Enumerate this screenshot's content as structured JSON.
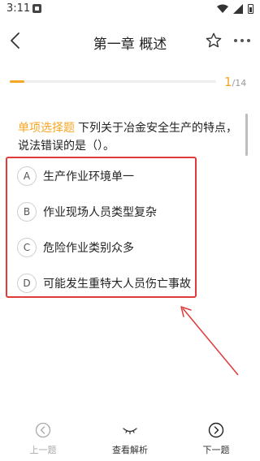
{
  "status_bar": {
    "time": "3:11"
  },
  "header": {
    "title": "第一章 概述"
  },
  "progress": {
    "current": "1",
    "total": "/14",
    "fraction": 0.071,
    "accent_color": "#f5a623"
  },
  "question": {
    "type_label": "单项选择题",
    "text": "下列关于冶金安全生产的特点，说法错误的是（）。"
  },
  "options": [
    {
      "letter": "A",
      "text": "生产作业环境单一"
    },
    {
      "letter": "B",
      "text": "作业现场人员类型复杂"
    },
    {
      "letter": "C",
      "text": "危险作业类别众多"
    },
    {
      "letter": "D",
      "text": "可能发生重特大人员伤亡事故"
    }
  ],
  "annotation": {
    "box_color": "#e03a3a"
  },
  "bottom_nav": {
    "prev_label": "上一题",
    "analysis_label": "查看解析",
    "next_label": "下一题"
  },
  "icons": [
    "back-icon",
    "star-icon",
    "more-icon",
    "prev-icon",
    "eye-icon",
    "next-icon",
    "wifi-icon",
    "signal-icon",
    "battery-icon"
  ]
}
